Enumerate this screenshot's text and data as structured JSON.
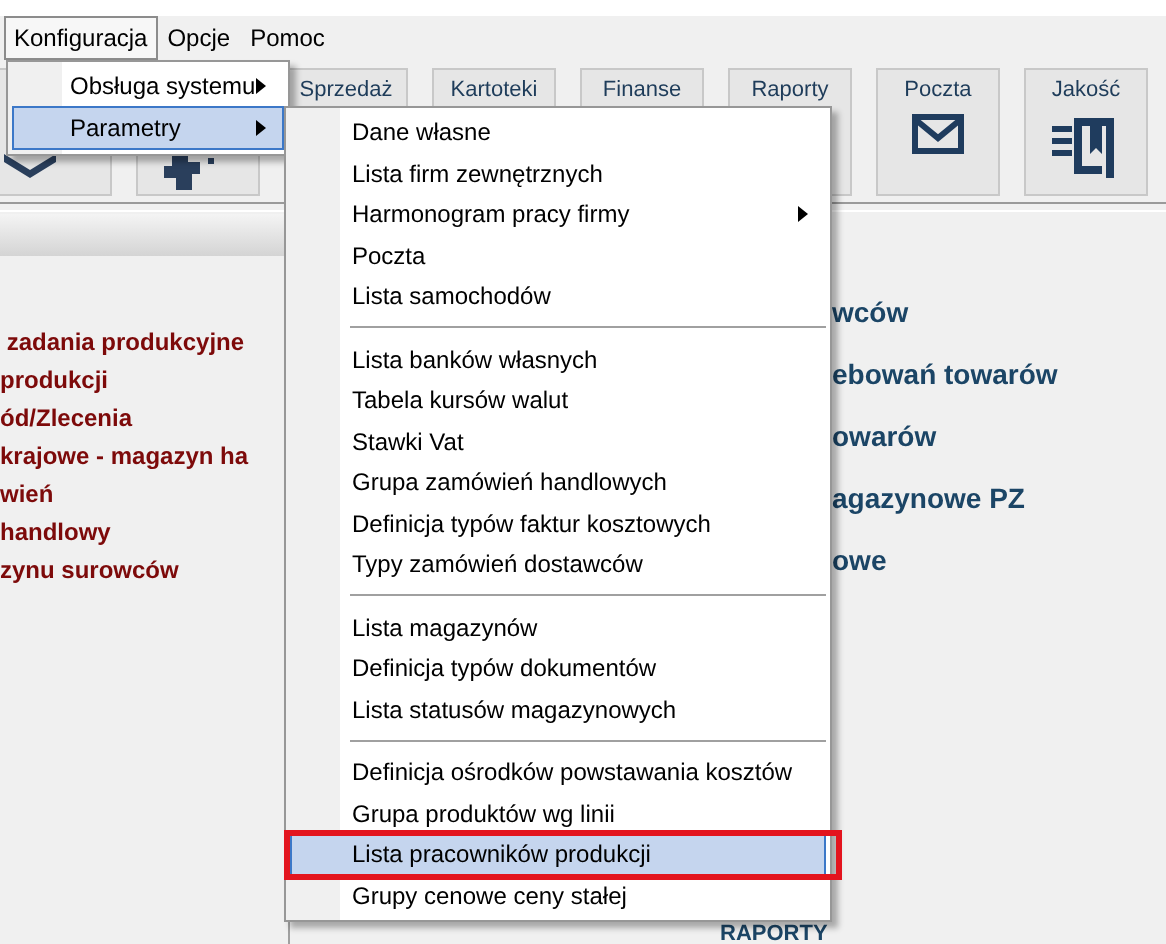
{
  "menubar": [
    {
      "label": "Konfiguracja",
      "selected": true
    },
    {
      "label": "Opcje",
      "selected": false
    },
    {
      "label": "Pomoc",
      "selected": false
    }
  ],
  "toolbar": [
    {
      "kind": "icon"
    },
    {
      "kind": "icon"
    },
    {
      "kind": "labelled",
      "label": "Sprzedaż"
    },
    {
      "kind": "labelled",
      "label": "Kartoteki"
    },
    {
      "kind": "labelled",
      "label": "Finanse"
    },
    {
      "kind": "labelled",
      "label": "Raporty"
    },
    {
      "kind": "labelled",
      "label": "Poczta"
    },
    {
      "kind": "labelled",
      "label": "Jakość"
    }
  ],
  "left_list": [
    " zadania produkcyjne",
    "produkcji",
    "ód/Zlecenia",
    "krajowe - magazyn ha",
    "wień",
    "handlowy",
    "zynu surowców"
  ],
  "right_list": [
    "wców",
    "ebowań towarów",
    "owarów",
    "agazynowe PZ",
    "owe"
  ],
  "bottom_label": "RAPORTY",
  "config_menu": [
    {
      "label": "Obsługa systemu",
      "has_submenu": true,
      "selected": false
    },
    {
      "label": "Parametry",
      "has_submenu": true,
      "selected": true
    }
  ],
  "parametry_menu": [
    {
      "kind": "item",
      "label": "Dane własne",
      "has_submenu": false,
      "selected": false,
      "annotated": false
    },
    {
      "kind": "item",
      "label": "Lista firm zewnętrznych",
      "has_submenu": false,
      "selected": false,
      "annotated": false
    },
    {
      "kind": "item",
      "label": "Harmonogram pracy firmy",
      "has_submenu": true,
      "selected": false,
      "annotated": false
    },
    {
      "kind": "item",
      "label": "Poczta",
      "has_submenu": false,
      "selected": false,
      "annotated": false
    },
    {
      "kind": "item",
      "label": "Lista samochodów",
      "has_submenu": false,
      "selected": false,
      "annotated": false
    },
    {
      "kind": "separator"
    },
    {
      "kind": "item",
      "label": "Lista banków własnych",
      "has_submenu": false,
      "selected": false,
      "annotated": false
    },
    {
      "kind": "item",
      "label": "Tabela kursów walut",
      "has_submenu": false,
      "selected": false,
      "annotated": false
    },
    {
      "kind": "item",
      "label": "Stawki Vat",
      "has_submenu": false,
      "selected": false,
      "annotated": false
    },
    {
      "kind": "item",
      "label": "Grupa zamówień handlowych",
      "has_submenu": false,
      "selected": false,
      "annotated": false
    },
    {
      "kind": "item",
      "label": "Definicja typów faktur kosztowych",
      "has_submenu": false,
      "selected": false,
      "annotated": false
    },
    {
      "kind": "item",
      "label": "Typy zamówień dostawców",
      "has_submenu": false,
      "selected": false,
      "annotated": false
    },
    {
      "kind": "separator"
    },
    {
      "kind": "item",
      "label": "Lista magazynów",
      "has_submenu": false,
      "selected": false,
      "annotated": false
    },
    {
      "kind": "item",
      "label": "Definicja typów dokumentów",
      "has_submenu": false,
      "selected": false,
      "annotated": false
    },
    {
      "kind": "item",
      "label": "Lista statusów magazynowych",
      "has_submenu": false,
      "selected": false,
      "annotated": false
    },
    {
      "kind": "separator"
    },
    {
      "kind": "item",
      "label": "Definicja ośrodków powstawania kosztów",
      "has_submenu": false,
      "selected": false,
      "annotated": false
    },
    {
      "kind": "item",
      "label": "Grupa produktów wg linii",
      "has_submenu": false,
      "selected": false,
      "annotated": false
    },
    {
      "kind": "item",
      "label": "Lista pracowników produkcji",
      "has_submenu": false,
      "selected": true,
      "annotated": true
    },
    {
      "kind": "item",
      "label": "Grupy cenowe ceny stałej",
      "has_submenu": false,
      "selected": false,
      "annotated": false
    }
  ]
}
